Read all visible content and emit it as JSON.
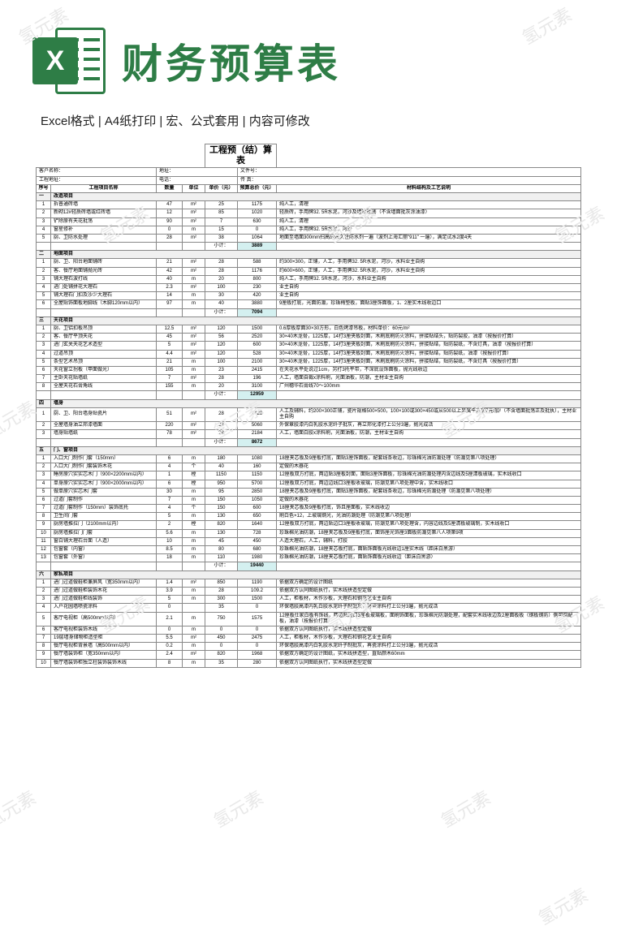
{
  "watermark_text": "氢元素",
  "header": {
    "icon_letter": "X",
    "title": "财务预算表"
  },
  "subtitle": "Excel格式 |  A4纸打印 | 宏、公式套用 | 内容可修改",
  "sheet": {
    "title": "工程预（结）算表",
    "meta": {
      "customer_label": "客户名称：",
      "addr_label": "工程地址：",
      "site_label": "地址：",
      "phone_label": "电话：",
      "file_label": "文件号：",
      "fax_label": "传  真："
    },
    "columns": {
      "idx": "序号",
      "name": "工程项目名称",
      "qty": "数量",
      "unit": "单位",
      "price": "单价（元）",
      "total": "预算总价（元）",
      "desc": "材料结构及工艺说明"
    },
    "subtotal_label": "小计：",
    "sections": [
      {
        "title": "改造项目",
        "rows": [
          {
            "idx": "1",
            "name": "拆普通砖墙",
            "qty": "47",
            "unit": "m²",
            "price": "25",
            "total": "1175",
            "desc": "纯人工，清理"
          },
          {
            "idx": "2",
            "name": "新砌12#轻质砖墙或红砖墙",
            "qty": "12",
            "unit": "m²",
            "price": "85",
            "total": "1020",
            "desc": "轻质砖，手用牌32. 5R水泥，河沙及墙面批荡（不含墙面批灰涂油漆）"
          },
          {
            "idx": "3",
            "name": "铲除原有天花批荡",
            "qty": "90",
            "unit": "m²",
            "price": "7",
            "total": "630",
            "desc": "纯人工，清理"
          },
          {
            "idx": "4",
            "name": "窗星修补",
            "qty": "0",
            "unit": "m",
            "price": "15",
            "total": "0",
            "desc": "纯人工，手用牌32. 5R水泥，河沙"
          },
          {
            "idx": "5",
            "name": "厨、卫防水处理",
            "qty": "28",
            "unit": "m²",
            "price": "38",
            "total": "1064",
            "desc": "地面至墙面300mm扫高的永久性防水剂一遍（波剂上海汇丽\"911\" 一遍），满足试水2度4天"
          }
        ],
        "subtotal": "3889"
      },
      {
        "title": "地面项目",
        "rows": [
          {
            "idx": "1",
            "name": "厨、卫、阳台地面铺砖",
            "qty": "21",
            "unit": "m²",
            "price": "28",
            "total": "588",
            "desc": "约300×300，正铺，人工，手用牌32. 5R水泥，河沙，水料业主自购"
          },
          {
            "idx": "2",
            "name": "客、餐厅地面铺抛光砖",
            "qty": "42",
            "unit": "m²",
            "price": "28",
            "total": "1176",
            "desc": "约600×600，正铺，人工，手用牌32. 5R水泥，河沙，水料业主自购"
          },
          {
            "idx": "3",
            "name": "铺大理石波打线",
            "qty": "40",
            "unit": "m",
            "price": "20",
            "total": "800",
            "desc": "纯人工，手用牌32. 5R水泥，河沙，水料业主自购"
          },
          {
            "idx": "4",
            "name": "进门处铺拼花大理石",
            "qty": "2.3",
            "unit": "m²",
            "price": "100",
            "total": "230",
            "desc": "业主自购"
          },
          {
            "idx": "5",
            "name": "铺大理石门扣及沙少大理石",
            "qty": "14",
            "unit": "m",
            "price": "30",
            "total": "420",
            "desc": "业主自购"
          },
          {
            "idx": "6",
            "name": "全屋贴饰面板地脚线（木脚120mm以内）",
            "qty": "97",
            "unit": "m",
            "price": "40",
            "total": "3880",
            "desc": "9厘板打底，光面防潮，珍珠梅垫板，面贴3厘饰面板，1、2厘实木线收边口"
          }
        ],
        "subtotal": "7094"
      },
      {
        "title": "天花项目",
        "rows": [
          {
            "idx": "1",
            "name": "厨、卫铝扣板吊顶",
            "qty": "12.5",
            "unit": "m²",
            "price": "120",
            "total": "1500",
            "desc": "0.6厚板厚面30×30方形，白色烤漆吊板，材料单价：60元/m²"
          },
          {
            "idx": "2",
            "name": "客、餐厅平顶天花",
            "qty": "45",
            "unit": "m²",
            "price": "56",
            "total": "2520",
            "desc": "30×40木龙骨，1225厚，14打3厘夹板封面，木刷底刷防火涂料，拼接贴结头，贴防裂胶，油漆（按报价打算）"
          },
          {
            "idx": "3",
            "name": "进门玄关天花艺术造型",
            "qty": "5",
            "unit": "m²",
            "price": "120",
            "total": "600",
            "desc": "30×40木龙骨，1225厚，14打3厘夹板封面，木刷底刷防火涂料，拼接贴结，贴防裂纸，不含灯具，油漆（按报价打算）"
          },
          {
            "idx": "4",
            "name": "过道吊顶",
            "qty": "4.4",
            "unit": "m²",
            "price": "120",
            "total": "528",
            "desc": "30×40木龙骨，1225厚，14打3厘夹板封面，木刷底刷防火涂料，拼接贴结，贴防裂纸，油漆（按报价打算）"
          },
          {
            "idx": "5",
            "name": "条型艺术吊顶",
            "qty": "21",
            "unit": "m",
            "price": "100",
            "total": "2100",
            "desc": "30×40木龙骨，1225厚，14打3厘夹板封面，木刷底刷防火涂料，拼接贴结，贴防裂纸，不含灯具（按报价打算）"
          },
          {
            "idx": "6",
            "name": "天花窗立拐板（甲面做光）",
            "qty": "105",
            "unit": "m",
            "price": "23",
            "total": "2415",
            "desc": "在天花水平处说过1cm，另打3托平带，不深底设饰面板，抛光线收边"
          },
          {
            "idx": "7",
            "name": "主卧天花贴墙纸",
            "qty": "7",
            "unit": "m²",
            "price": "28",
            "total": "196",
            "desc": "人工，墙面自裁x涂料刷，光面油板，防潮，主材业主自购"
          },
          {
            "idx": "8",
            "name": "全屋天花石膏角线",
            "qty": "155",
            "unit": "m",
            "price": "20",
            "total": "3100",
            "desc": "广州穗华石膏线70～100mm"
          }
        ],
        "subtotal": "12959"
      },
      {
        "title": "墙身",
        "rows": [
          {
            "idx": "1",
            "name": "厨、卫、阳台墙身贴瓷片",
            "qty": "51",
            "unit": "m²",
            "price": "28",
            "total": "1428",
            "desc": "人工及辅料，约200×300正铺，瓷片规格500×500，100×100或300×450或从500以上另属平方加7元/加²（不含墙面批荡正及批执），主材业主自购"
          },
          {
            "idx": "2",
            "name": "全屋墙身油立邦漆墙面",
            "qty": "220",
            "unit": "m²",
            "price": "23",
            "total": "5060",
            "desc": "外保章胶漆内白乳胶水泥纤子批灰，再立邦化漆打上公分3遍，抛光成活"
          },
          {
            "idx": "3",
            "name": "墙身贴墙纸",
            "qty": "78",
            "unit": "m²",
            "price": "28",
            "total": "2184",
            "desc": "人工，墙面白胶x涂料刷，光面油板，防潮，主材业主自购"
          }
        ],
        "subtotal": "8672"
      },
      {
        "title": "门、窗项目",
        "rows": [
          {
            "idx": "1",
            "name": "入口大门制作门套（150mm）",
            "qty": "6",
            "unit": "m",
            "price": "180",
            "total": "1080",
            "desc": "18厘夹芯板及9厘板打底，面贴3厘饰面板，配套线条收边，珍珠棉光油防潮处理（防潮见第八项处理）"
          },
          {
            "idx": "2",
            "name": "入口大门制作门套装饰木花",
            "qty": "4",
            "unit": "个",
            "price": "40",
            "total": "160",
            "desc": "定做的木器花"
          },
          {
            "idx": "3",
            "name": "睡房原穴实实芯木门（900×2200mm以内）",
            "qty": "1",
            "unit": "樘",
            "price": "1150",
            "total": "1150",
            "desc": "12厘板双方打底，两边贴3厘板封面，面贴3厘饰面板，珍珠棉光油防潮处理内含边线及5厘清板玻璃，实木线收口"
          },
          {
            "idx": "4",
            "name": "单身原穴实实芯木门（900×2000mm以内）",
            "qty": "6",
            "unit": "樘",
            "price": "950",
            "total": "5700",
            "desc": "12厘板双方打底，两边边线口3厘板收玻璃，防潮见第八项处理中含，实木线收口"
          },
          {
            "idx": "5",
            "name": "做单原穴实芯木门套",
            "qty": "30",
            "unit": "m",
            "price": "95",
            "total": "2850",
            "desc": "18厘夹芯板及9厘板打底，面贴3厘饰面板，配套线条收边，珍珠棉光防潮处理（防潮见第八项处理）"
          },
          {
            "idx": "6",
            "name": "过道门套制作",
            "qty": "7",
            "unit": "m",
            "price": "150",
            "total": "1050",
            "desc": "定做的木器花"
          },
          {
            "idx": "7",
            "name": "过道门套制作（150mm）装饰底托",
            "qty": "4",
            "unit": "个",
            "price": "150",
            "total": "600",
            "desc": "18厘夹芯板及9厘板打底，饰且厘面板，实木线收边"
          },
          {
            "idx": "8",
            "name": "卫生间门套",
            "qty": "5",
            "unit": "m",
            "price": "130",
            "total": "650",
            "desc": "刷白色×12，上玻璃钢光，光油防潮处理（防潮见第八项处理）"
          },
          {
            "idx": "9",
            "name": "厨房墙推拉门（2100mm以内）",
            "qty": "2",
            "unit": "樘",
            "price": "820",
            "total": "1640",
            "desc": "12厘板双方打底，两边贴边口3厘板收玻璃，防潮见第八项处理含，内容边线及5厘清板玻璃制，实木线收口"
          },
          {
            "idx": "10",
            "name": "厨房墙推拉门门套",
            "qty": "5.6",
            "unit": "m",
            "price": "130",
            "total": "728",
            "desc": "珍珠棉光油防潮，18厘夹芯板及9厘板打底，面饰厘光饰厘3面板防潮见第八人项第9项"
          },
          {
            "idx": "11",
            "name": "窗白铺大理石台面（人造）",
            "qty": "10",
            "unit": "m",
            "price": "45",
            "total": "450",
            "desc": "人造大理石，人工，辅料，打胶"
          },
          {
            "idx": "12",
            "name": "包窗套（内窗）",
            "qty": "8.5",
            "unit": "m",
            "price": "80",
            "total": "680",
            "desc": "珍珠棉光油防潮，18厘夹芯板打底，面贴饰面板光线收边1厘实木线（距床白黑游）"
          },
          {
            "idx": "13",
            "name": "包窗套（外窗）",
            "qty": "18",
            "unit": "m",
            "price": "110",
            "total": "1980",
            "desc": "珍珠棉光油防潮，18厘夹芯板打底，面贴饰面板光线收边（距床白黑游）"
          }
        ],
        "subtotal": "19440"
      },
      {
        "title": "家私项目",
        "rows": [
          {
            "idx": "1",
            "name": "进门过道做鞋柜兼屏风（宽350mm以内）",
            "qty": "1.4",
            "unit": "m²",
            "price": "850",
            "total": "1190",
            "desc": "依据双方确定的设计图纸"
          },
          {
            "idx": "2",
            "name": "进门过道做鞋柜装饰木花",
            "qty": "3.9",
            "unit": "m",
            "price": "28",
            "total": "109.2",
            "desc": "依据双方认同图纸执行，实木线拼造型定做"
          },
          {
            "idx": "3",
            "name": "进门过道做鞋柜线装饰",
            "qty": "5",
            "unit": "m",
            "price": "300",
            "total": "1500",
            "desc": "人工，柜板材，木作沙板，大理石和钢花艺业主自购"
          },
          {
            "idx": "4",
            "name": "入户花园墙喷瓷涂料",
            "qty": "0",
            "unit": "",
            "price": "35",
            "total": "0",
            "desc": "环保墙胶高漆内乳白胶水泥纤子制批灰，再瓷涂料打上公分3遍，抛光成活"
          },
          {
            "idx": "5",
            "name": "客厅电视柜（高500mm以内）",
            "qty": "2.1",
            "unit": "m",
            "price": "750",
            "total": "1575",
            "desc": "12厘板仕家白板有饰线，两边贴边口3厘板玻璃板，面刷饰面板，珍珠棉光防潮处理，配套实木线收边及2厘面板板（钢板钢防）侧可暗配板，油漆（按报价打算）"
          },
          {
            "idx": "6",
            "name": "客厅电视柜装饰木线",
            "qty": "0",
            "unit": "m",
            "price": "0",
            "total": "0",
            "desc": "依据双方认同图纸执行，实木线拼造型定做"
          },
          {
            "idx": "7",
            "name": "19层墙身储物柜造型柜",
            "qty": "5.5",
            "unit": "m²",
            "price": "450",
            "total": "2475",
            "desc": "人工，柜板材，木作沙板，大理石和钢花艺业主自购"
          },
          {
            "idx": "8",
            "name": "餐厅电视柜背景墙（高500mm以内）",
            "qty": "0.2",
            "unit": "m",
            "price": "0",
            "total": "0",
            "desc": "环保墙胶高漆内白乳胶水泥纤子制批灰，再瓷涂料打上公分3遍，抛光成活"
          },
          {
            "idx": "9",
            "name": "餐厅墙装饰柜（宽350mm以内）",
            "qty": "2.4",
            "unit": "m²",
            "price": "820",
            "total": "1968",
            "desc": "依据双方确定的设计图纸，实木线拼造型，直贴颜木60mm"
          },
          {
            "idx": "10",
            "name": "餐厅墙装饰柜独立柱装饰装饰木线",
            "qty": "8",
            "unit": "m",
            "price": "35",
            "total": "280",
            "desc": "依据双方认同图纸执行，实木线拼造型定做"
          }
        ],
        "subtotal": null
      }
    ]
  }
}
